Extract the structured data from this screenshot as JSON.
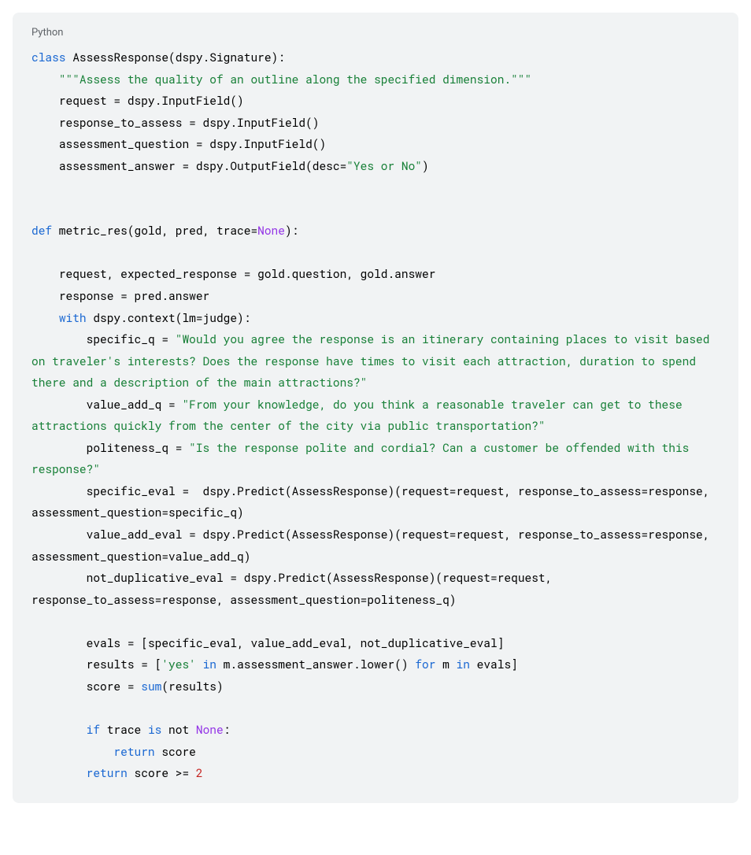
{
  "language_label": "Python",
  "code": {
    "lines": [
      {
        "indent": 0,
        "parts": [
          {
            "t": "class",
            "c": "kw-blue"
          },
          {
            "t": " AssessResponse(dspy.Signature):"
          }
        ]
      },
      {
        "indent": 1,
        "parts": [
          {
            "t": "\"\"\"Assess the quality of an outline along the specified dimension.\"\"\"",
            "c": "str-green"
          }
        ]
      },
      {
        "indent": 1,
        "parts": [
          {
            "t": "request = dspy.InputField()"
          }
        ]
      },
      {
        "indent": 1,
        "parts": [
          {
            "t": "response_to_assess = dspy.InputField()"
          }
        ]
      },
      {
        "indent": 1,
        "parts": [
          {
            "t": "assessment_question = dspy.InputField()"
          }
        ]
      },
      {
        "indent": 1,
        "parts": [
          {
            "t": "assessment_answer = dspy.OutputField(desc="
          },
          {
            "t": "\"Yes or No\"",
            "c": "str-green"
          },
          {
            "t": ")"
          }
        ]
      },
      {
        "indent": 0,
        "parts": [
          {
            "t": ""
          }
        ]
      },
      {
        "indent": 0,
        "parts": [
          {
            "t": ""
          }
        ]
      },
      {
        "indent": 0,
        "parts": [
          {
            "t": "def",
            "c": "kw-blue"
          },
          {
            "t": " metric_res(gold, pred, trace="
          },
          {
            "t": "None",
            "c": "kw-purple"
          },
          {
            "t": "):"
          }
        ]
      },
      {
        "indent": 0,
        "parts": [
          {
            "t": ""
          }
        ]
      },
      {
        "indent": 1,
        "parts": [
          {
            "t": "request, expected_response = gold.question, gold.answer"
          }
        ]
      },
      {
        "indent": 1,
        "parts": [
          {
            "t": "response = pred.answer"
          }
        ]
      },
      {
        "indent": 1,
        "parts": [
          {
            "t": "with",
            "c": "kw-blue"
          },
          {
            "t": " dspy.context(lm=judge):"
          }
        ]
      },
      {
        "indent": 2,
        "parts": [
          {
            "t": "specific_q = "
          },
          {
            "t": "\"Would you agree the response is an itinerary containing places to visit based on traveler's interests? Does the response have times to visit each attraction, duration to spend there and a description of the main attractions?\"",
            "c": "str-green"
          }
        ]
      },
      {
        "indent": 2,
        "parts": [
          {
            "t": "value_add_q = "
          },
          {
            "t": "\"From your knowledge, do you think a reasonable traveler can get to these attractions quickly from the center of the city via public transportation?\"",
            "c": "str-green"
          }
        ]
      },
      {
        "indent": 2,
        "parts": [
          {
            "t": "politeness_q = "
          },
          {
            "t": "\"Is the response polite and cordial? Can a customer be offended with this response?\"",
            "c": "str-green"
          }
        ]
      },
      {
        "indent": 2,
        "parts": [
          {
            "t": "specific_eval =  dspy.Predict(AssessResponse)(request=request, response_to_assess=response, assessment_question=specific_q)"
          }
        ]
      },
      {
        "indent": 2,
        "parts": [
          {
            "t": "value_add_eval = dspy.Predict(AssessResponse)(request=request, response_to_assess=response, assessment_question=value_add_q)"
          }
        ]
      },
      {
        "indent": 2,
        "parts": [
          {
            "t": "not_duplicative_eval = dspy.Predict(AssessResponse)(request=request, response_to_assess=response, assessment_question=politeness_q)"
          }
        ]
      },
      {
        "indent": 0,
        "parts": [
          {
            "t": ""
          }
        ]
      },
      {
        "indent": 2,
        "parts": [
          {
            "t": "evals = [specific_eval, value_add_eval, not_duplicative_eval]"
          }
        ]
      },
      {
        "indent": 2,
        "parts": [
          {
            "t": "results = ["
          },
          {
            "t": "'yes'",
            "c": "str-green"
          },
          {
            "t": " "
          },
          {
            "t": "in",
            "c": "kw-blue"
          },
          {
            "t": " m.assessment_answer.lower() "
          },
          {
            "t": "for",
            "c": "kw-blue"
          },
          {
            "t": " m "
          },
          {
            "t": "in",
            "c": "kw-blue"
          },
          {
            "t": " evals]"
          }
        ]
      },
      {
        "indent": 2,
        "parts": [
          {
            "t": "score = "
          },
          {
            "t": "sum",
            "c": "kw-blue"
          },
          {
            "t": "(results)"
          }
        ]
      },
      {
        "indent": 0,
        "parts": [
          {
            "t": ""
          }
        ]
      },
      {
        "indent": 2,
        "parts": [
          {
            "t": "if",
            "c": "kw-blue"
          },
          {
            "t": " trace "
          },
          {
            "t": "is",
            "c": "kw-blue"
          },
          {
            "t": " not "
          },
          {
            "t": "None",
            "c": "kw-purple"
          },
          {
            "t": ":"
          }
        ]
      },
      {
        "indent": 3,
        "parts": [
          {
            "t": "return",
            "c": "kw-blue"
          },
          {
            "t": " score"
          }
        ]
      },
      {
        "indent": 2,
        "parts": [
          {
            "t": "return",
            "c": "kw-blue"
          },
          {
            "t": " score >= "
          },
          {
            "t": "2",
            "c": "num-red"
          }
        ]
      }
    ]
  }
}
